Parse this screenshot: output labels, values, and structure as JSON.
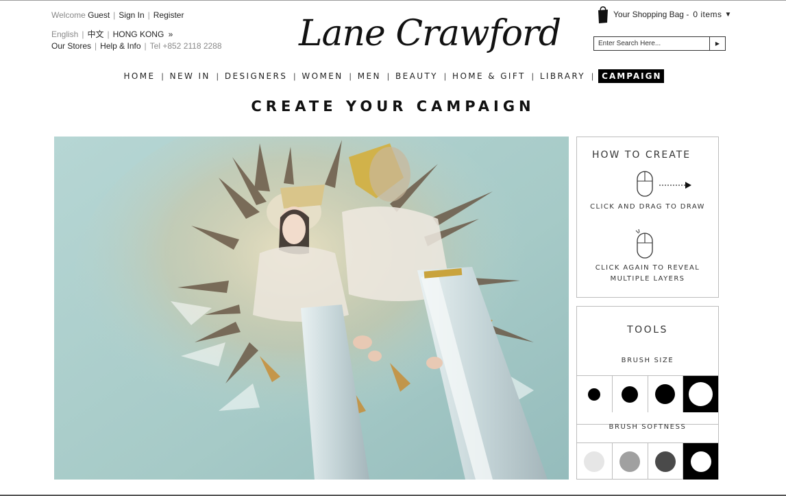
{
  "header": {
    "welcome": "Welcome",
    "guest": "Guest",
    "sign_in": "Sign In",
    "register": "Register",
    "lang_english": "English",
    "lang_chinese": "中文",
    "region": "HONG KONG",
    "region_arrow": "»",
    "our_stores": "Our Stores",
    "help_info": "Help & Info",
    "tel": "Tel +852 2118 2288",
    "logo": "Lane Crawford",
    "bag_label": "Your Shopping Bag -",
    "bag_count": "0 items",
    "bag_caret": "▼",
    "search_placeholder": "Enter Search Here...",
    "search_go": "▶"
  },
  "nav": {
    "items": [
      "HOME",
      "NEW IN",
      "DESIGNERS",
      "WOMEN",
      "MEN",
      "BEAUTY",
      "HOME & GIFT",
      "LIBRARY",
      "CAMPAIGN"
    ],
    "active": "CAMPAIGN"
  },
  "page_title": "CREATE YOUR CAMPAIGN",
  "how_to": {
    "title": "HOW TO CREATE",
    "step1": "CLICK AND DRAG TO DRAW",
    "step2_line1": "CLICK AGAIN TO REVEAL",
    "step2_line2": "MULTIPLE LAYERS"
  },
  "tools": {
    "title": "TOOLS",
    "brush_size_label": "BRUSH SIZE",
    "brush_sizes": [
      "small",
      "medium",
      "large",
      "extra-large"
    ],
    "brush_size_selected": "extra-large",
    "brush_softness_label": "BRUSH SOFTNESS",
    "brush_softness": [
      "light",
      "medium",
      "dark",
      "solid"
    ],
    "brush_softness_colors": [
      "#e6e6e6",
      "#a0a0a0",
      "#4a4a4a",
      "#ffffff"
    ],
    "brush_softness_selected": "solid"
  },
  "colors": {
    "canvas_background": "#a8cdc9",
    "nav_active_bg": "#000000",
    "panel_border": "#bcbcbc"
  }
}
